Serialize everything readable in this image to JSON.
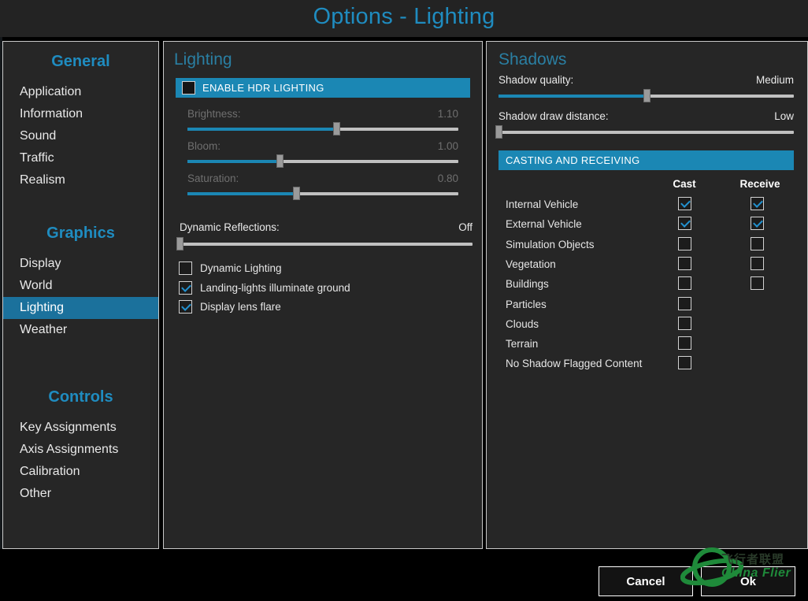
{
  "window": {
    "title": "Options - Lighting",
    "accent_blue": "#1b87b4",
    "title_blue": "#1f8cc0",
    "panel_bg": "#262626"
  },
  "sidebar": {
    "groups": [
      {
        "title": "General",
        "items": [
          {
            "label": "Application",
            "selected": false
          },
          {
            "label": "Information",
            "selected": false
          },
          {
            "label": "Sound",
            "selected": false
          },
          {
            "label": "Traffic",
            "selected": false
          },
          {
            "label": "Realism",
            "selected": false
          }
        ]
      },
      {
        "title": "Graphics",
        "items": [
          {
            "label": "Display",
            "selected": false
          },
          {
            "label": "World",
            "selected": false
          },
          {
            "label": "Lighting",
            "selected": true
          },
          {
            "label": "Weather",
            "selected": false
          }
        ]
      },
      {
        "title": "Controls",
        "items": [
          {
            "label": "Key Assignments",
            "selected": false
          },
          {
            "label": "Axis Assignments",
            "selected": false
          },
          {
            "label": "Calibration",
            "selected": false
          },
          {
            "label": "Other",
            "selected": false
          }
        ]
      }
    ]
  },
  "lighting": {
    "title": "Lighting",
    "hdr_bar_label": "ENABLE HDR LIGHTING",
    "hdr_checked": false,
    "sliders": [
      {
        "label": "Brightness:",
        "value": "1.10",
        "percent": 55,
        "enabled": false
      },
      {
        "label": "Bloom:",
        "value": "1.00",
        "percent": 34,
        "enabled": false
      },
      {
        "label": "Saturation:",
        "value": "0.80",
        "percent": 40,
        "enabled": false
      }
    ],
    "reflections": {
      "label": "Dynamic Reflections:",
      "value": "Off",
      "percent": 0
    },
    "options": [
      {
        "label": "Dynamic Lighting",
        "checked": false
      },
      {
        "label": "Landing-lights illuminate ground",
        "checked": true
      },
      {
        "label": "Display lens flare",
        "checked": true
      }
    ]
  },
  "shadows": {
    "title": "Shadows",
    "sliders": [
      {
        "label": "Shadow quality:",
        "value": "Medium",
        "percent": 50
      },
      {
        "label": "Shadow draw distance:",
        "value": "Low",
        "percent": 0
      }
    ],
    "casting_bar_label": "CASTING AND RECEIVING",
    "columns": [
      "Cast",
      "Receive"
    ],
    "rows": [
      {
        "label": "Internal Vehicle",
        "cast": true,
        "cast_shown": true,
        "receive": true,
        "receive_shown": true
      },
      {
        "label": "External Vehicle",
        "cast": true,
        "cast_shown": true,
        "receive": true,
        "receive_shown": true
      },
      {
        "label": "Simulation Objects",
        "cast": false,
        "cast_shown": true,
        "receive": false,
        "receive_shown": true
      },
      {
        "label": "Vegetation",
        "cast": false,
        "cast_shown": true,
        "receive": false,
        "receive_shown": true
      },
      {
        "label": "Buildings",
        "cast": false,
        "cast_shown": true,
        "receive": false,
        "receive_shown": true
      },
      {
        "label": "Particles",
        "cast": false,
        "cast_shown": true,
        "receive": false,
        "receive_shown": false
      },
      {
        "label": "Clouds",
        "cast": false,
        "cast_shown": true,
        "receive": false,
        "receive_shown": false
      },
      {
        "label": "Terrain",
        "cast": false,
        "cast_shown": true,
        "receive": false,
        "receive_shown": false
      },
      {
        "label": "No Shadow Flagged Content",
        "cast": false,
        "cast_shown": true,
        "receive": false,
        "receive_shown": false
      }
    ]
  },
  "footer": {
    "cancel_label": "Cancel",
    "ok_label": "Ok"
  },
  "watermark": {
    "chinese": "飞行者联盟",
    "english": "China Flier"
  }
}
